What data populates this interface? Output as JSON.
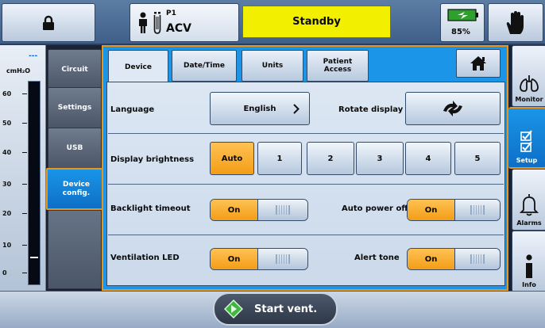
{
  "topbar": {
    "patient_id": "P1",
    "mode": "ACV",
    "status": "Standby",
    "battery": "85%",
    "status_color": "#f2ef00"
  },
  "gauge": {
    "value_placeholder": "---",
    "unit": "cmH₂O",
    "ticks": [
      "60",
      "50",
      "40",
      "30",
      "20",
      "10",
      "0"
    ]
  },
  "left_nav": {
    "items": [
      {
        "label": "Circuit"
      },
      {
        "label": "Settings"
      },
      {
        "label": "USB"
      },
      {
        "label_line1": "Device",
        "label_line2": "config."
      }
    ]
  },
  "tabs": {
    "device": "Device",
    "datetime": "Date/Time",
    "units": "Units",
    "patient_access_1": "Patient",
    "patient_access_2": "Access"
  },
  "settings": {
    "language_label": "Language",
    "language_value": "English",
    "rotate_label": "Rotate display",
    "brightness_label": "Display brightness",
    "brightness_options": [
      "Auto",
      "1",
      "2",
      "3",
      "4",
      "5"
    ],
    "brightness_selected": "Auto",
    "backlight_label": "Backlight timeout",
    "backlight_value": "On",
    "auto_power_label": "Auto power off",
    "auto_power_value": "On",
    "led_label": "Ventilation LED",
    "led_value": "On",
    "alert_tone_label": "Alert tone",
    "alert_tone_value": "On"
  },
  "right_nav": {
    "monitor": "Monitor",
    "setup": "Setup",
    "alarms": "Alarms",
    "info": "Info"
  },
  "bottom": {
    "start_label": "Start vent."
  },
  "colors": {
    "accent_orange": "#f39d16",
    "active_blue": "#1a95e8"
  }
}
